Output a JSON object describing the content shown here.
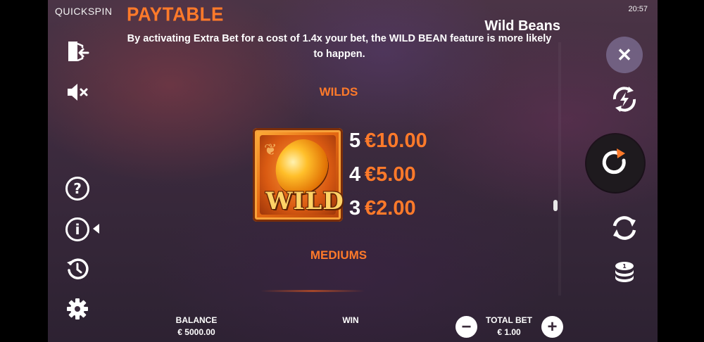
{
  "status_bar": {
    "brand": "QUICKSPIN",
    "clock": "20:57"
  },
  "paytable": {
    "title": "PAYTABLE",
    "game_title": "Wild Beans",
    "intro_text": "By activating Extra Bet for a cost of 1.4x your bet, the WILD BEAN feature is more likely to happen.",
    "sections": {
      "wilds": {
        "heading": "WILDS",
        "symbol_text": "WILD",
        "symbol_icon": "wild-bean-icon",
        "payouts": [
          {
            "count": "5",
            "amount": "€10.00"
          },
          {
            "count": "4",
            "amount": "€5.00"
          },
          {
            "count": "3",
            "amount": "€2.00"
          }
        ]
      },
      "mediums": {
        "heading": "MEDIUMS"
      }
    }
  },
  "left_menu": [
    {
      "name": "exit-icon"
    },
    {
      "name": "sound-muted-icon"
    },
    {
      "name": "help-icon",
      "glyph": "?"
    },
    {
      "name": "info-icon",
      "glyph": "i"
    },
    {
      "name": "history-icon"
    },
    {
      "name": "settings-gear-icon"
    }
  ],
  "right_controls": {
    "close_glyph": "✕",
    "close_icon": "close-icon",
    "turbo_icon": "turbo-lightning-icon",
    "spin_icon": "spin-icon",
    "autoplay_icon": "autoplay-icon",
    "bet_icon": "coins-icon"
  },
  "footer": {
    "balance_label": "BALANCE",
    "balance_value": "€ 5000.00",
    "win_label": "WIN",
    "total_bet_label": "TOTAL BET",
    "total_bet_value": "€ 1.00",
    "decrease_glyph": "−",
    "increase_glyph": "+"
  },
  "colors": {
    "accent_orange": "#ff7a2a",
    "text_white": "#ffffff",
    "close_button_bg": "#786990",
    "spin_button_bg": "#1e1a1e"
  }
}
